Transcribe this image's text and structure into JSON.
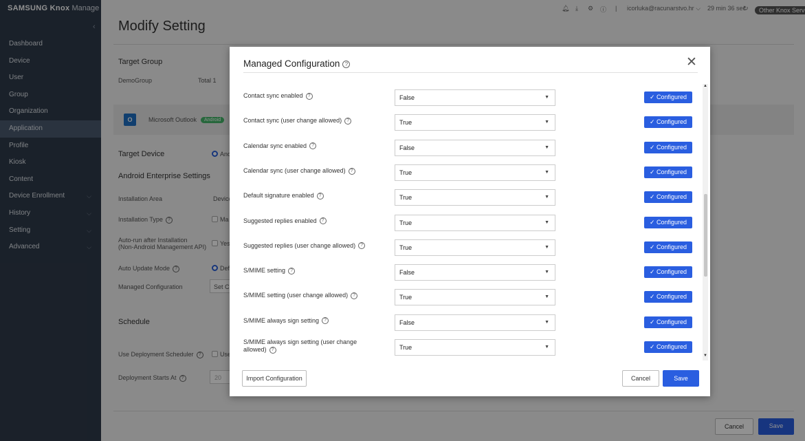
{
  "sidebar": {
    "logo_bold": "SAMSUNG Knox",
    "logo_light": "Manage",
    "collapse_icon": "chevron-left-icon",
    "items": [
      {
        "label": "Dashboard"
      },
      {
        "label": "Device"
      },
      {
        "label": "User"
      },
      {
        "label": "Group"
      },
      {
        "label": "Organization"
      },
      {
        "label": "Application"
      },
      {
        "label": "Profile"
      },
      {
        "label": "Kiosk"
      },
      {
        "label": "Content"
      },
      {
        "label": "Device Enrollment"
      },
      {
        "label": "History"
      },
      {
        "label": "Setting"
      },
      {
        "label": "Advanced"
      }
    ],
    "active_index": 5
  },
  "topbar": {
    "user": "icorluka@racunarstvo.hr",
    "session": "29 min 36 sec",
    "badge": "Other Knox Servi"
  },
  "page": {
    "title": "Modify Setting",
    "target_group_heading": "Target Group",
    "group_name": "DemoGroup",
    "total_label": "Total 1",
    "app_name": "Microsoft Outlook",
    "app_badge": "Android",
    "target_device_label": "Target Device",
    "target_device_value": "And",
    "ae_heading": "Android Enterprise Settings",
    "installation_area_label": "Installation Area",
    "installation_area_value": "Device",
    "installation_type_label": "Installation Type",
    "installation_type_value": "Ma",
    "auto_run_label_1": "Auto-run after Installation",
    "auto_run_label_2": "(Non-Android Management API)",
    "auto_run_value": "Yes",
    "auto_update_label": "Auto Update Mode",
    "auto_update_value": "Def",
    "managed_config_label": "Managed Configuration",
    "managed_config_value": "Set C",
    "schedule_heading": "Schedule",
    "use_scheduler_label": "Use Deployment Scheduler",
    "use_scheduler_value": "Use",
    "deploy_starts_label": "Deployment Starts At",
    "deploy_starts_value": "20",
    "cancel_label": "Cancel",
    "save_label": "Save"
  },
  "modal": {
    "title": "Managed Configuration",
    "help_glyph": "?",
    "close_glyph": "✕",
    "configured_label": "✓ Configured",
    "rows": [
      {
        "name": "Contact sync enabled",
        "value": "False"
      },
      {
        "name": "Contact sync (user change allowed)",
        "value": "True"
      },
      {
        "name": "Calendar sync enabled",
        "value": "False"
      },
      {
        "name": "Calendar sync (user change allowed)",
        "value": "True"
      },
      {
        "name": "Default signature enabled",
        "value": "True"
      },
      {
        "name": "Suggested replies enabled",
        "value": "True"
      },
      {
        "name": "Suggested replies (user change allowed)",
        "value": "True"
      },
      {
        "name": "S/MIME setting",
        "value": "False"
      },
      {
        "name": "S/MIME setting (user change allowed)",
        "value": "True"
      },
      {
        "name": "S/MIME always sign setting",
        "value": "False"
      },
      {
        "name": "S/MIME always sign setting (user change allowed)",
        "value": "True"
      }
    ],
    "import_label": "Import Configuration",
    "cancel_label": "Cancel",
    "save_label": "Save"
  },
  "colors": {
    "accent": "#2a5ee0",
    "sidebar_bg": "#2f3a4a",
    "badge_green": "#45b56a"
  }
}
